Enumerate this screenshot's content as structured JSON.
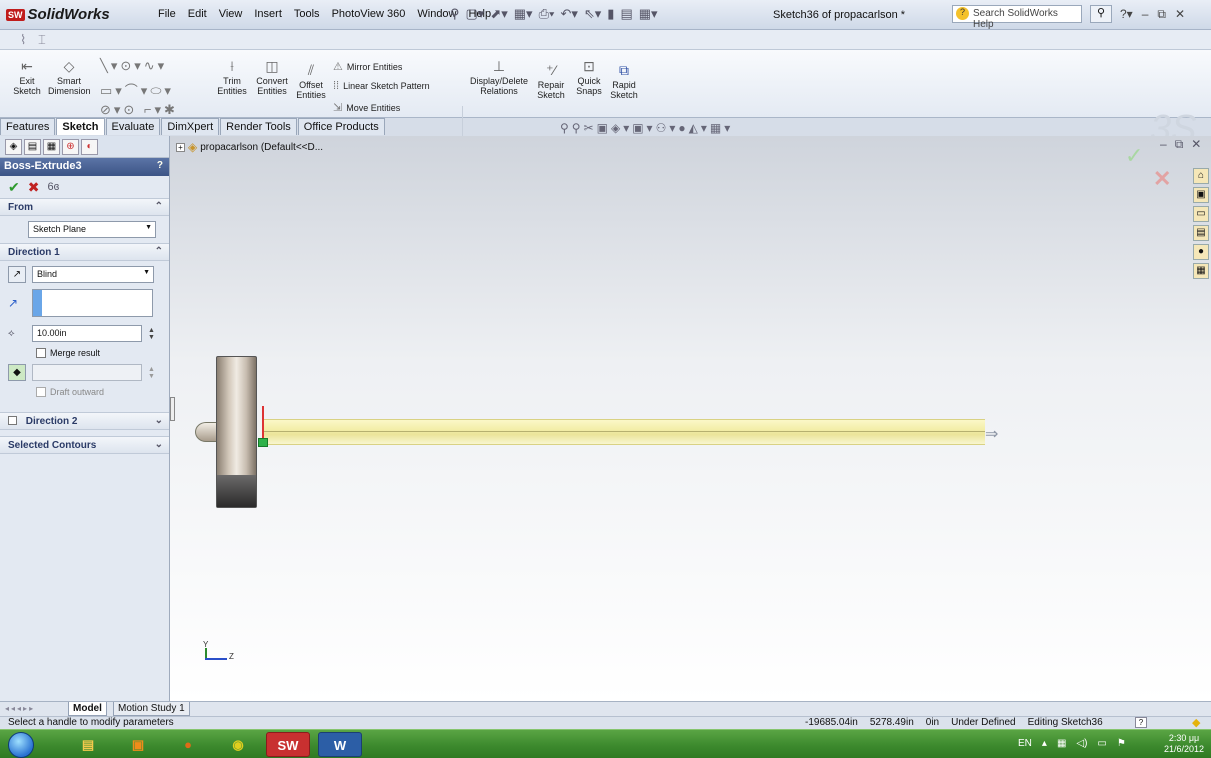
{
  "app": {
    "name": "SolidWorks",
    "logo_badge": "SW",
    "menu": [
      "File",
      "Edit",
      "View",
      "Insert",
      "Tools",
      "PhotoView 360",
      "Window",
      "Help"
    ],
    "document_title": "Sketch36 of propacarlson *",
    "search_placeholder": "Search SolidWorks Help"
  },
  "command_manager": {
    "exit_sketch": "Exit Sketch",
    "smart_dimension": "Smart Dimension",
    "trim_entities": "Trim Entities",
    "convert_entities": "Convert Entities",
    "offset_entities": "Offset Entities",
    "mirror_entities": "Mirror Entities",
    "linear_sketch_pattern": "Linear Sketch Pattern",
    "move_entities": "Move Entities",
    "display_delete_relations": "Display/Delete Relations",
    "repair_sketch": "Repair Sketch",
    "quick_snaps": "Quick Snaps",
    "rapid_sketch": "Rapid Sketch"
  },
  "tabs": [
    {
      "label": "Features",
      "active": false
    },
    {
      "label": "Sketch",
      "active": true
    },
    {
      "label": "Evaluate",
      "active": false
    },
    {
      "label": "DimXpert",
      "active": false
    },
    {
      "label": "Render Tools",
      "active": false
    },
    {
      "label": "Office Products",
      "active": false
    }
  ],
  "feature_tree_node": "propacarlson  (Default<<D...",
  "property_manager": {
    "title": "Boss-Extrude3",
    "from": {
      "header": "From",
      "value": "Sketch Plane"
    },
    "direction1": {
      "header": "Direction 1",
      "end_condition": "Blind",
      "depth": "10.00in",
      "merge_result": "Merge result",
      "merge_checked": false,
      "draft_outward": "Draft outward"
    },
    "direction2": {
      "header": "Direction 2",
      "checked": false
    },
    "selected_contours": {
      "header": "Selected Contours"
    }
  },
  "model_tabs": [
    {
      "label": "Model",
      "active": true
    },
    {
      "label": "Motion Study 1",
      "active": false
    }
  ],
  "status_bar": {
    "message": "Select a handle to modify parameters",
    "x": "-19685.04in",
    "y": "5278.49in",
    "z": "0in",
    "state": "Under Defined",
    "editing": "Editing Sketch36"
  },
  "taskbar": {
    "word_label": "W",
    "sw_label": "SW",
    "language": "EN",
    "time": "2:30 μμ",
    "date": "21/6/2012"
  },
  "triad": {
    "y": "Y",
    "z": "Z"
  },
  "colors": {
    "accent_blue": "#3c5486",
    "ok_green": "#2d9a2d",
    "cancel_red": "#c02222",
    "shaft_yellow": "#f3eea8",
    "taskbar_green": "#3d8a2e"
  }
}
